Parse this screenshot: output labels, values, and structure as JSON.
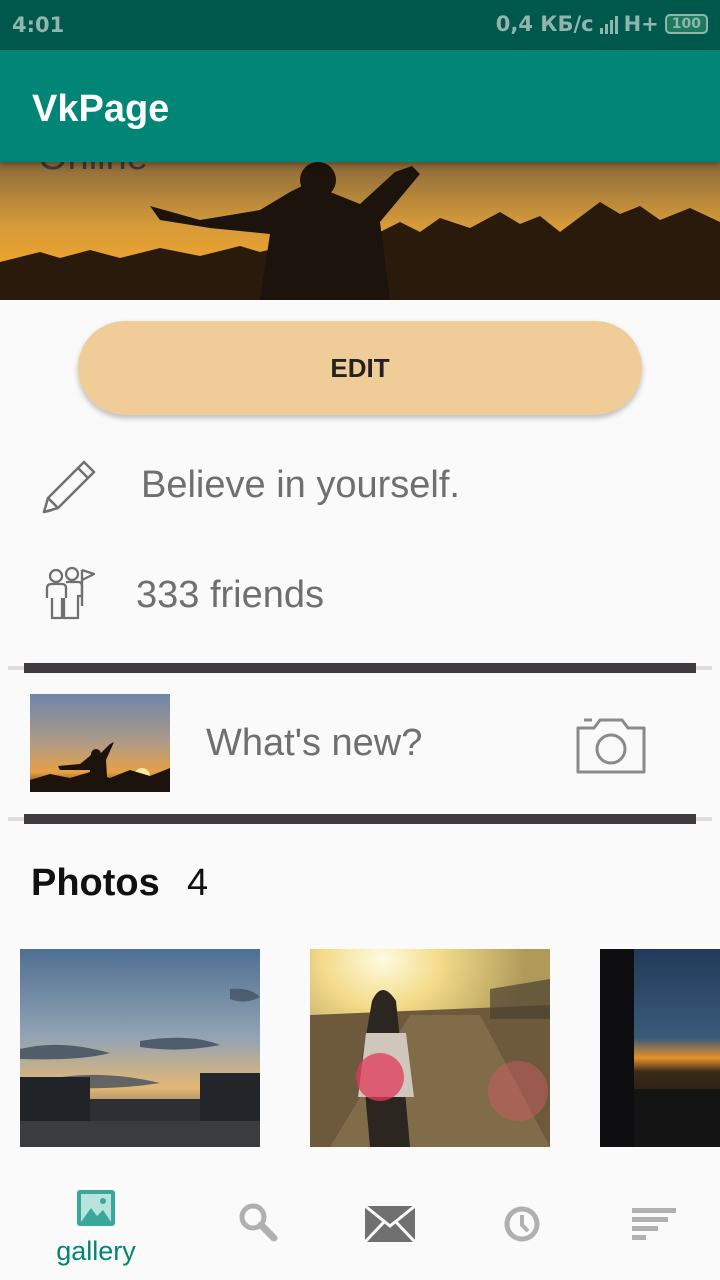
{
  "status_bar": {
    "time": "4:01",
    "network_speed": "0,4 КБ/с",
    "network_type": "H+",
    "battery": "100"
  },
  "app_bar": {
    "title": "VkPage"
  },
  "profile": {
    "online_status": "Online",
    "edit_label": "EDIT",
    "status_text": "Believe in yourself.",
    "friends_text": "333 friends"
  },
  "post": {
    "placeholder": "What's new?"
  },
  "photos": {
    "title": "Photos",
    "count": "4"
  },
  "bottom_nav": {
    "items": [
      {
        "icon": "gallery-icon",
        "label": "gallery",
        "active": true
      },
      {
        "icon": "search-icon",
        "label": "",
        "active": false
      },
      {
        "icon": "mail-icon",
        "label": "",
        "active": false
      },
      {
        "icon": "clock-icon",
        "label": "",
        "active": false
      },
      {
        "icon": "sort-icon",
        "label": "",
        "active": false
      }
    ]
  },
  "colors": {
    "primary": "#008577",
    "primary_dark": "#00574b",
    "edit_button": "#efcc98",
    "divider": "#3e3a3d",
    "text_secondary": "#6f6f6f"
  }
}
